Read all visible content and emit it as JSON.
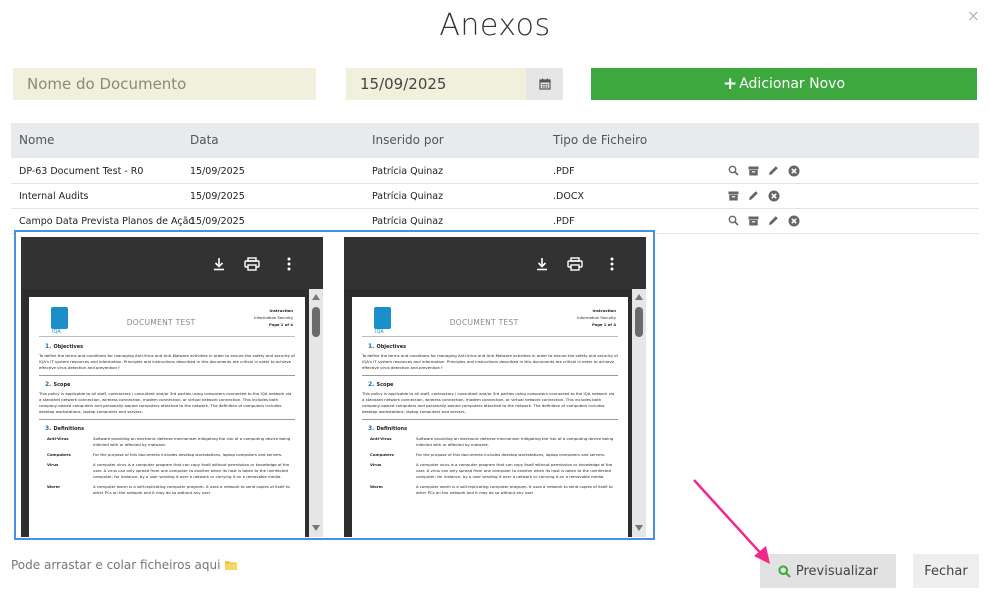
{
  "dialog": {
    "title": "Anexos",
    "close_glyph": "×"
  },
  "form": {
    "doc_name_placeholder": "Nome do Documento",
    "date_value": "15/09/2025",
    "add_button_label": "Adicionar Novo"
  },
  "table": {
    "headers": [
      "Nome",
      "Data",
      "Inserido por",
      "Tipo de Ficheiro"
    ],
    "rows": [
      {
        "name": "DP-63 Document Test - R0",
        "date": "15/09/2025",
        "inserted_by": "Patrícia Quinaz",
        "type": ".PDF",
        "actions": [
          "search-icon",
          "archive-icon",
          "edit-icon",
          "remove-icon"
        ]
      },
      {
        "name": "Internal Audits",
        "date": "15/09/2025",
        "inserted_by": "Patrícia Quinaz",
        "type": ".DOCX",
        "actions": [
          "archive-icon",
          "edit-icon",
          "remove-icon"
        ]
      },
      {
        "name": "Campo Data Prevista Planos de Ação",
        "date": "15/09/2025",
        "inserted_by": "Patrícia Quinaz",
        "type": ".PDF",
        "actions": [
          "search-icon",
          "archive-icon",
          "edit-icon",
          "remove-icon"
        ]
      }
    ]
  },
  "preview": {
    "logo_text": "IQA",
    "doc_title": "DOCUMENT TEST",
    "meta_1": "Instruction",
    "meta_2": "Information Security",
    "meta_3": "Page 1 of 4",
    "sec1_num": "1.",
    "sec1_title": "Objectives",
    "sec1_text": "To define the terms and conditions for managing Anti-Virus and Anti-Malware activities in order to ensure the safety and security of IQA's IT system resources and information. Principles and instructions described in this documents are critical in order to achieve effective virus detection and prevention f",
    "sec2_num": "2.",
    "sec2_title": "Scope",
    "sec2_text": "This policy is applicable to all staff, contractors / consultant and/or 3rd parties using computers connected to the IQA network via a standard network connection, wireless connection, modem connection, or virtual network connection. This includes both company-owned computers and personally-owned computers attached to the network. The definition of computers includes desktop workstations, laptop computers and servers.",
    "sec3_num": "3.",
    "sec3_title": "Definitions",
    "definitions": [
      {
        "term": "Anti-Virus",
        "text": "Software providing an electronic defense mechanism mitigating the risk of a computing device being infected with or affected by malware."
      },
      {
        "term": "Computers",
        "text": "For the purpose of this documents includes desktop workstations, laptop computers and servers."
      },
      {
        "term": "Virus",
        "text": "A computer virus is a computer program that can copy itself without permission or knowledge of the user. A virus can only spread from one computer to another when its host is taken to the uninfected computer; for instance, by a user sending it over a network or carrying it on a removable media."
      },
      {
        "term": "Worm",
        "text": "A computer worm is a self-replicating computer program. It uses a network to send copies of itself to other PCs on the network and it may do so without any user"
      }
    ]
  },
  "footer": {
    "drop_hint": "Pode arrastar e colar ficheiros aqui",
    "preview_label": "Previsualizar",
    "close_label": "Fechar"
  },
  "colors": {
    "accent_green": "#3da83d",
    "preview_border": "#4a90e2",
    "arrow": "#f0288c"
  }
}
